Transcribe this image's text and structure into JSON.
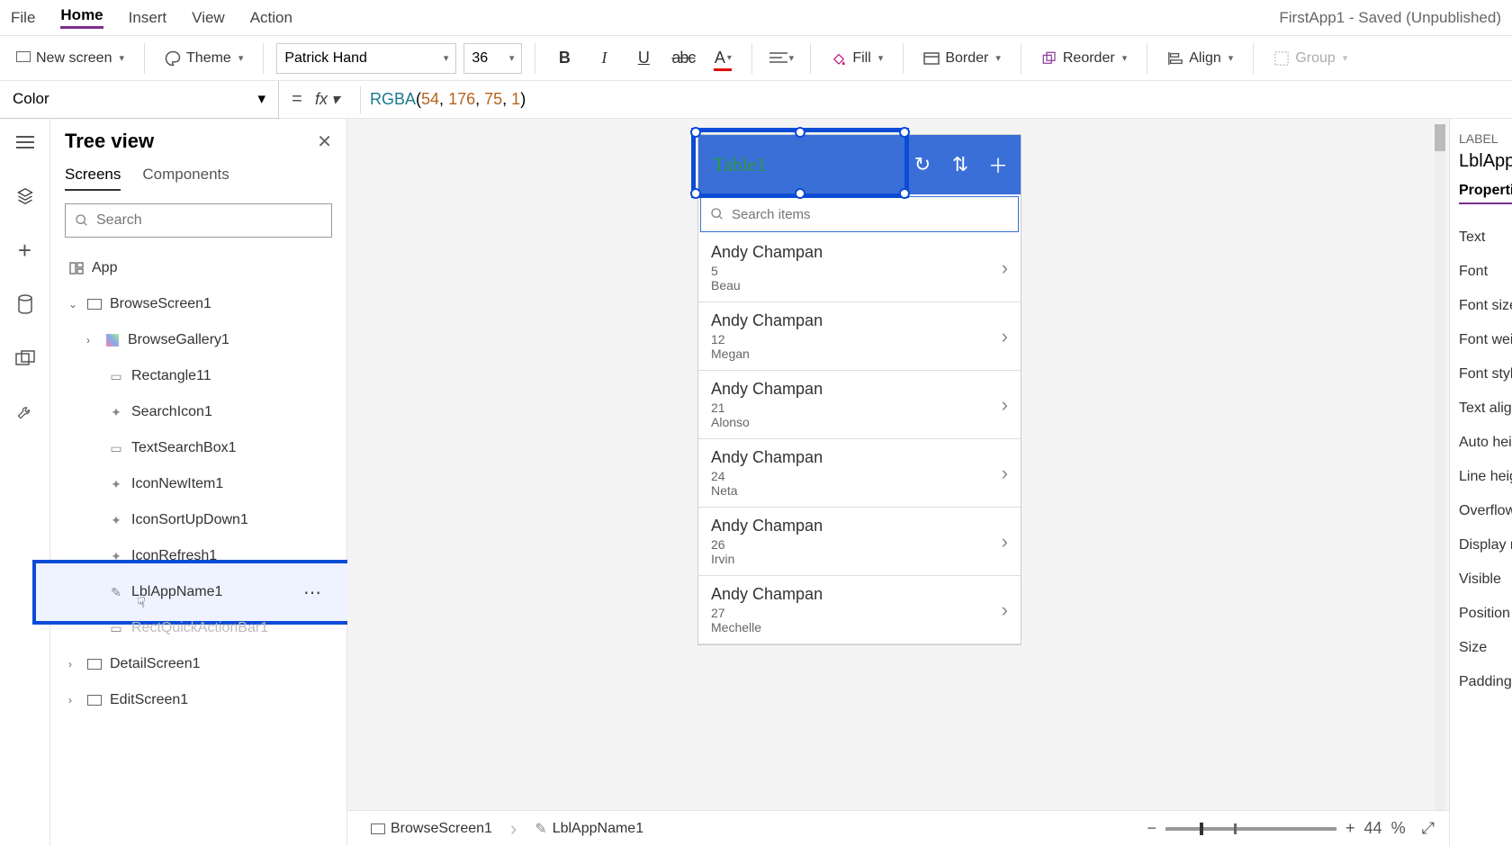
{
  "app_title": "FirstApp1 - Saved (Unpublished)",
  "menus": {
    "file": "File",
    "home": "Home",
    "insert": "Insert",
    "view": "View",
    "action": "Action"
  },
  "ribbon": {
    "new_screen": "New screen",
    "theme": "Theme",
    "font": "Patrick Hand",
    "font_size": "36",
    "fill": "Fill",
    "border": "Border",
    "reorder": "Reorder",
    "align": "Align",
    "group": "Group"
  },
  "formula": {
    "property": "Color",
    "fx": "fx",
    "fn": "RGBA",
    "args": "(54, 176, 75, 1)"
  },
  "treeview": {
    "title": "Tree view",
    "tabs": {
      "screens": "Screens",
      "components": "Components"
    },
    "search_placeholder": "Search",
    "items": {
      "app": "App",
      "browse_screen": "BrowseScreen1",
      "gallery": "BrowseGallery1",
      "rect": "Rectangle11",
      "search_icon": "SearchIcon1",
      "search_box": "TextSearchBox1",
      "new_item": "IconNewItem1",
      "sort": "IconSortUpDown1",
      "refresh": "IconRefresh1",
      "lbl_app": "LblAppName1",
      "rect_action": "RectQuickActionBar1",
      "detail_screen": "DetailScreen1",
      "edit_screen": "EditScreen1"
    }
  },
  "canvas": {
    "header_title": "Table1",
    "search_placeholder": "Search items",
    "rows": [
      {
        "name": "Andy Champan",
        "num": "5",
        "sub": "Beau"
      },
      {
        "name": "Andy Champan",
        "num": "12",
        "sub": "Megan"
      },
      {
        "name": "Andy Champan",
        "num": "21",
        "sub": "Alonso"
      },
      {
        "name": "Andy Champan",
        "num": "24",
        "sub": "Neta"
      },
      {
        "name": "Andy Champan",
        "num": "26",
        "sub": "Irvin"
      },
      {
        "name": "Andy Champan",
        "num": "27",
        "sub": "Mechelle"
      }
    ]
  },
  "breadcrumb": {
    "a": "BrowseScreen1",
    "b": "LblAppName1"
  },
  "zoom": {
    "value": "44",
    "unit": "%"
  },
  "properties": {
    "category": "LABEL",
    "name": "LblAppN",
    "tab": "Propertie",
    "rows": [
      "Text",
      "Font",
      "Font size",
      "Font weig",
      "Font style",
      "Text align",
      "Auto heig",
      "Line heigh",
      "Overflow",
      "Display m",
      "Visible",
      "Position",
      "Size",
      "Padding"
    ]
  }
}
